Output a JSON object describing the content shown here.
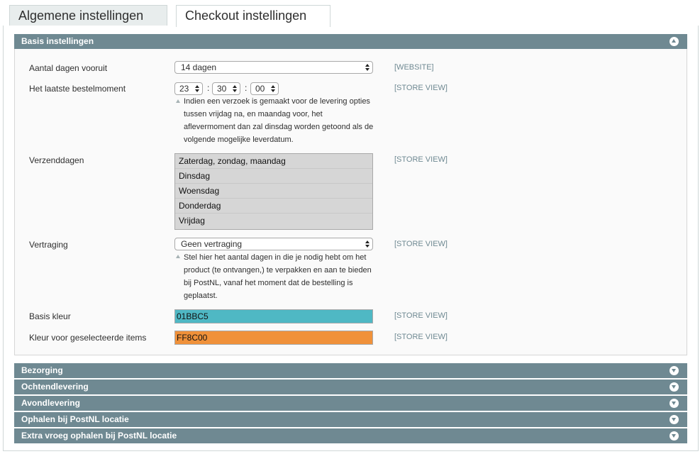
{
  "tabs": {
    "general": "Algemene instellingen",
    "checkout": "Checkout instellingen"
  },
  "basis": {
    "title": "Basis instellingen",
    "days_ahead": {
      "label": "Aantal dagen vooruit",
      "value": "14 dagen",
      "scope": "[WEBSITE]"
    },
    "cutoff": {
      "label": "Het laatste bestelmoment",
      "hour": "23",
      "minute": "30",
      "second": "00",
      "separator": ":",
      "scope": "[STORE VIEW]",
      "note_lines": [
        "Indien een verzoek is gemaakt voor de levering opties",
        "tussen vrijdag na, en maandag voor, het",
        "aflevermoment dan zal dinsdag worden getoond als de",
        "volgende mogelijke leverdatum."
      ]
    },
    "shipping_days": {
      "label": "Verzenddagen",
      "scope": "[STORE VIEW]",
      "options": [
        "Zaterdag, zondag, maandag",
        "Dinsdag",
        "Woensdag",
        "Donderdag",
        "Vrijdag"
      ]
    },
    "delay": {
      "label": "Vertraging",
      "value": "Geen vertraging",
      "scope": "[STORE VIEW]",
      "note_lines": [
        "Stel hier het aantal dagen in die je nodig hebt om het",
        "product (te ontvangen,) te verpakken en aan te bieden",
        "bij PostNL, vanaf het moment dat de bestelling is",
        "geplaatst."
      ]
    },
    "base_color": {
      "label": "Basis kleur",
      "value": "01BBC5",
      "color": "#4FB8C4",
      "scope": "[STORE VIEW]"
    },
    "selected_color": {
      "label": "Kleur voor geselecteerde items",
      "value": "FF8C00",
      "color": "#F0913A",
      "scope": "[STORE VIEW]"
    }
  },
  "collapsed_sections": [
    "Bezorging",
    "Ochtendlevering",
    "Avondlevering",
    "Ophalen bij PostNL locatie",
    "Extra vroeg ophalen bij PostNL locatie"
  ],
  "colors": {
    "header_bg": "#6F8992",
    "scope_text": "#6F8992"
  }
}
